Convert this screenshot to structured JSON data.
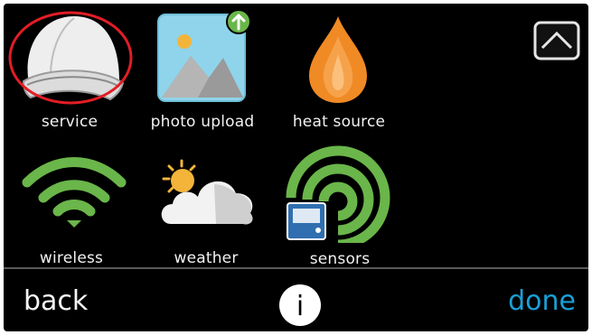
{
  "tiles": [
    {
      "label": "service",
      "icon": "service-cap-icon",
      "highlighted": true
    },
    {
      "label": "photo upload",
      "icon": "photo-upload-icon"
    },
    {
      "label": "heat source",
      "icon": "flame-icon"
    },
    {
      "label": "wireless",
      "icon": "wifi-icon"
    },
    {
      "label": "weather",
      "icon": "weather-icon"
    },
    {
      "label": "sensors",
      "icon": "sensors-icon"
    }
  ],
  "footer": {
    "back_label": "back",
    "done_label": "done",
    "info_label": "i"
  },
  "colors": {
    "background": "#000000",
    "done": "#1a9fd6",
    "highlight_ring": "#e21d26",
    "green": "#6ab64a",
    "flame": "#f08a24"
  }
}
